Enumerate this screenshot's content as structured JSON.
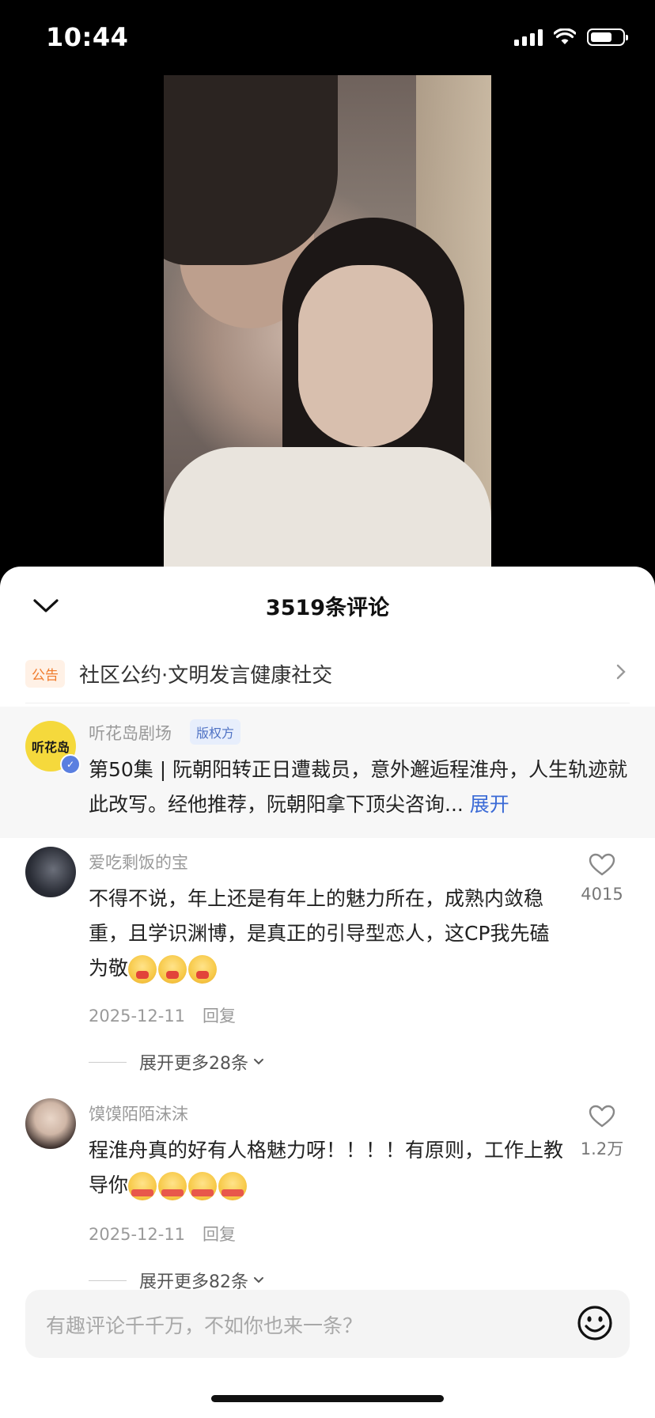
{
  "status_bar": {
    "time": "10:44"
  },
  "sheet": {
    "title": "3519条评论",
    "notice": {
      "badge": "公告",
      "text": "社区公约·文明发言健康社交"
    }
  },
  "pinned": {
    "avatar_text": "听花岛",
    "author": "听花岛剧场",
    "badge": "版权方",
    "text": "第50集 | 阮朝阳转正日遭裁员，意外邂逅程淮舟，人生轨迹就此改写。经他推荐，阮朝阳拿下顶尖咨询...",
    "expand": "展开"
  },
  "comments": [
    {
      "author": "爱吃剩饭的宝",
      "text": "不得不说，年上还是有年上的魅力所在，成熟内敛稳重，且学识渊博，是真正的引导型恋人，这CP我先磕为敬",
      "emojis": [
        "drooling",
        "drooling",
        "drooling"
      ],
      "date": "2025-12-11",
      "reply": "回复",
      "likes": "4015",
      "more_replies": "展开更多28条"
    },
    {
      "author": "馍馍陌陌沫沫",
      "text": "程淮舟真的好有人格魅力呀！！！！有原则，工作上教导你",
      "emojis": [
        "not-enough",
        "not-enough",
        "not-enough",
        "not-enough"
      ],
      "emoji_tag_text": "没看够",
      "date": "2025-12-11",
      "reply": "回复",
      "likes": "1.2万",
      "more_replies": "展开更多82条"
    }
  ],
  "input": {
    "placeholder": "有趣评论千千万，不如你也来一条？"
  }
}
